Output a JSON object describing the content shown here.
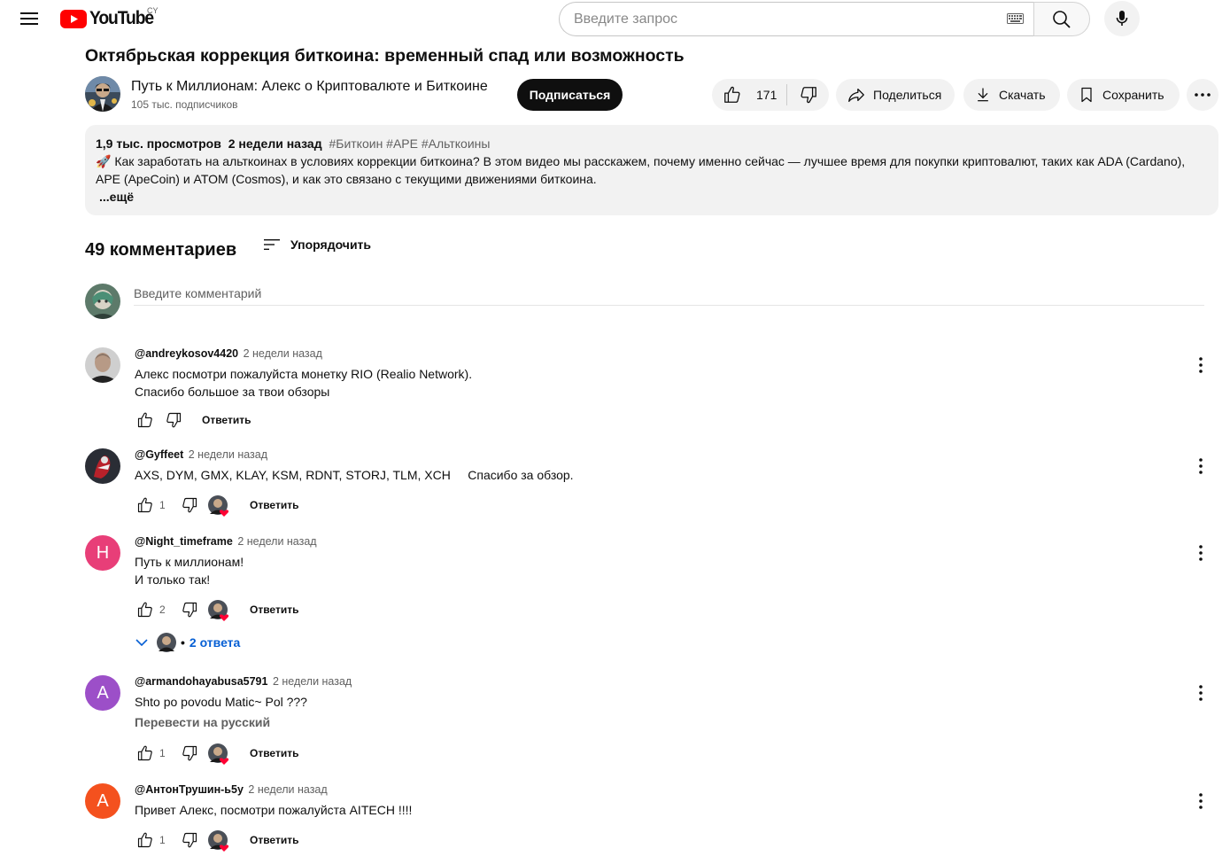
{
  "header": {
    "logo_text": "YouTube",
    "country_code": "CY",
    "search_placeholder": "Введите запрос"
  },
  "video": {
    "title": "Октябрьская коррекция биткоина: временный спад или возможность",
    "channel_name": "Путь к Миллионам: Алекс о Криптовалюте и Биткоине",
    "subscribers": "105 тыс. подписчиков",
    "subscribe_label": "Подписаться",
    "likes": "171",
    "share_label": "Поделиться",
    "download_label": "Скачать",
    "save_label": "Сохранить"
  },
  "description": {
    "views": "1,9 тыс. просмотров",
    "date": "2 недели назад",
    "tags": "#Биткоин #APE #Альткоины",
    "text_line1": "🚀 Как заработать на альткоинах в условиях коррекции биткоина? В этом видео мы расскажем, почему именно сейчас — лучшее время для покупки криптовалют, таких как ADA (Cardano),",
    "text_line2": "APE (ApeCoin) и ATOM (Cosmos), и как это связано с текущими движениями биткоина.",
    "more_label": "...ещё"
  },
  "comments_section": {
    "count_label": "49 комментариев",
    "sort_label": "Упорядочить",
    "input_placeholder": "Введите комментарий",
    "reply_label": "Ответить"
  },
  "comments": [
    {
      "author": "@andreykosov4420",
      "time": "2 недели назад",
      "text": "Алекс посмотри пожалуйста монетку RIO (Realio Network).\nСпасибо большое за твои обзоры",
      "likes": "",
      "creator_hearted": false
    },
    {
      "author": "@Gyffeet",
      "time": "2 недели назад",
      "text": "AXS, DYM, GMX, KLAY, KSM, RDNT, STORJ, TLM, XCH     Спасибо за обзор.",
      "likes": "1",
      "creator_hearted": true
    },
    {
      "author": "@Night_timeframe",
      "time": "2 недели назад",
      "text": "Путь к миллионам!\nИ только так!",
      "likes": "2",
      "creator_hearted": true,
      "avatar_letter": "H",
      "avatar_color": "#e83e78",
      "replies_label": "2 ответа"
    },
    {
      "author": "@armandohayabusa5791",
      "time": "2 недели назад",
      "text": "Shto po povodu Matic~ Pol ???",
      "translate_label": "Перевести на русский",
      "likes": "1",
      "creator_hearted": true,
      "avatar_letter": "A",
      "avatar_color": "#9c4fc8"
    },
    {
      "author": "@АнтонТрушин-ь5у",
      "time": "2 недели назад",
      "text": "Привет Алекс, посмотри пожалуйста AITECH !!!!",
      "likes": "1",
      "creator_hearted": true,
      "avatar_letter": "A",
      "avatar_color": "#f4511e"
    }
  ],
  "colors": {
    "brand_red": "#ff0000",
    "link_blue": "#065fd4",
    "heart_red": "#ff0033"
  }
}
